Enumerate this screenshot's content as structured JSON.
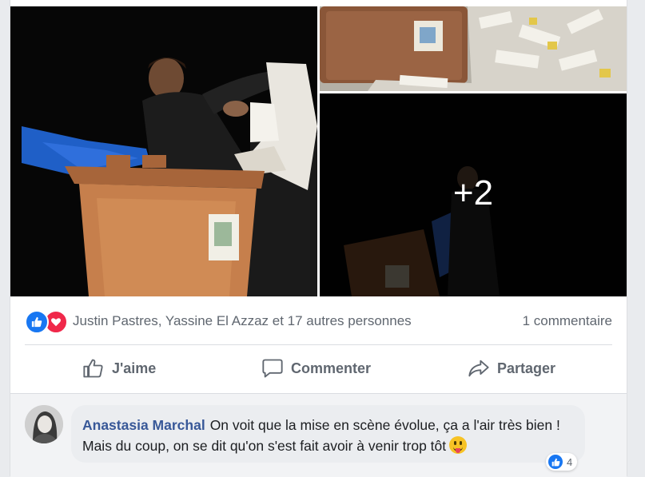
{
  "post": {
    "more_photos_label": "+2"
  },
  "reactions": {
    "names": "Justin Pastres, Yassine El Azzaz et 17 autres personnes",
    "comment_count": "1 commentaire"
  },
  "actions": {
    "like_label": "J'aime",
    "comment_label": "Commenter",
    "share_label": "Partager"
  },
  "comment": {
    "author": "Anastasia Marchal",
    "text": "On voit que la mise en scène évolue, ça a l'air très bien ! Mais du coup, on se dit qu'on s'est fait avoir à venir trop tôt",
    "emoji": "stuck-out-tongue-emoji",
    "like_count": "4"
  },
  "colors": {
    "link": "#385898",
    "like_blue": "#1877f2",
    "love_red": "#f0284a",
    "muted_text": "#606770"
  }
}
